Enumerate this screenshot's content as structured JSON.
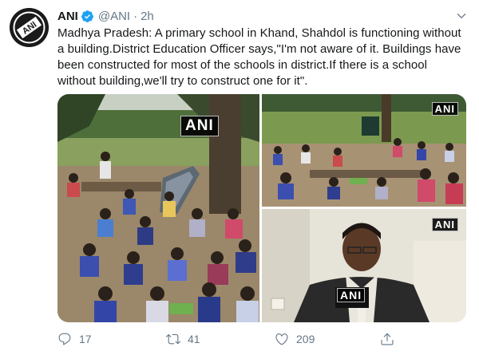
{
  "tweet": {
    "display_name": "ANI",
    "handle": "@ANI",
    "separator": "·",
    "time": "2h",
    "text": "Madhya Pradesh: A primary school in Khand, Shahdol is functioning without a building.District Education Officer says,\"I'm not aware of it. Buildings have been constructed for most of the schools in district.If there is a school without building,we'll try to construct one for it\".",
    "avatar_text": "ANI"
  },
  "media": {
    "watermark_1": "ANI",
    "watermark_2": "ANI",
    "watermark_3": "ANI",
    "watermark_4": "ANI"
  },
  "actions": {
    "reply_count": "17",
    "retweet_count": "41",
    "like_count": "209"
  },
  "icons": {
    "verified": "verified-badge-icon",
    "caret": "chevron-down-icon",
    "reply": "reply-icon",
    "retweet": "retweet-icon",
    "like": "heart-icon",
    "share": "share-icon"
  },
  "colors": {
    "verified_blue": "#1da1f2",
    "secondary_text": "#657786",
    "primary_text": "#14171a"
  }
}
